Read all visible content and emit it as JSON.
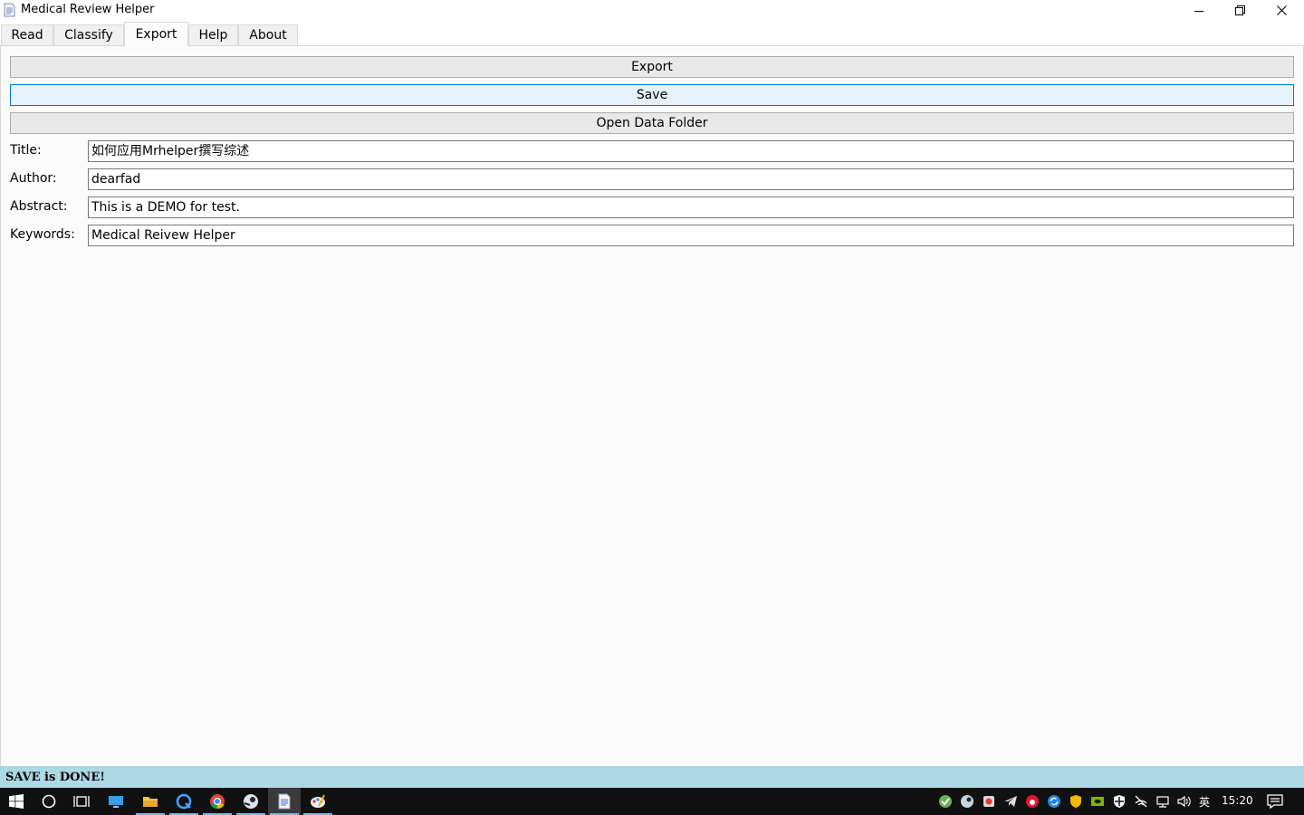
{
  "window": {
    "title": "Medical Review Helper"
  },
  "tabs": [
    {
      "label": "Read"
    },
    {
      "label": "Classify"
    },
    {
      "label": "Export"
    },
    {
      "label": "Help"
    },
    {
      "label": "About"
    }
  ],
  "active_tab": "Export",
  "actions": {
    "export_label": "Export",
    "save_label": "Save",
    "open_folder_label": "Open Data Folder"
  },
  "form": {
    "title": {
      "label": "Title:",
      "value": "如何应用Mrhelper撰写综述"
    },
    "author": {
      "label": "Author:",
      "value": "dearfad"
    },
    "abstract": {
      "label": "Abstract:",
      "value": "This is a DEMO for test."
    },
    "keywords": {
      "label": "Keywords:",
      "value": "Medical Reivew Helper"
    }
  },
  "status": {
    "message": "SAVE is DONE!",
    "background": "#add8e6"
  },
  "taskbar": {
    "pinned": [
      "windows-start-icon",
      "search-circle-icon",
      "task-view-icon",
      "desktop-app-icon",
      "file-explorer-icon",
      "browser-q-icon",
      "chrome-icon",
      "steam-icon",
      "medical-review-helper-icon",
      "paint-icon"
    ],
    "tray": {
      "ime": "英",
      "clock": "15:20"
    }
  }
}
